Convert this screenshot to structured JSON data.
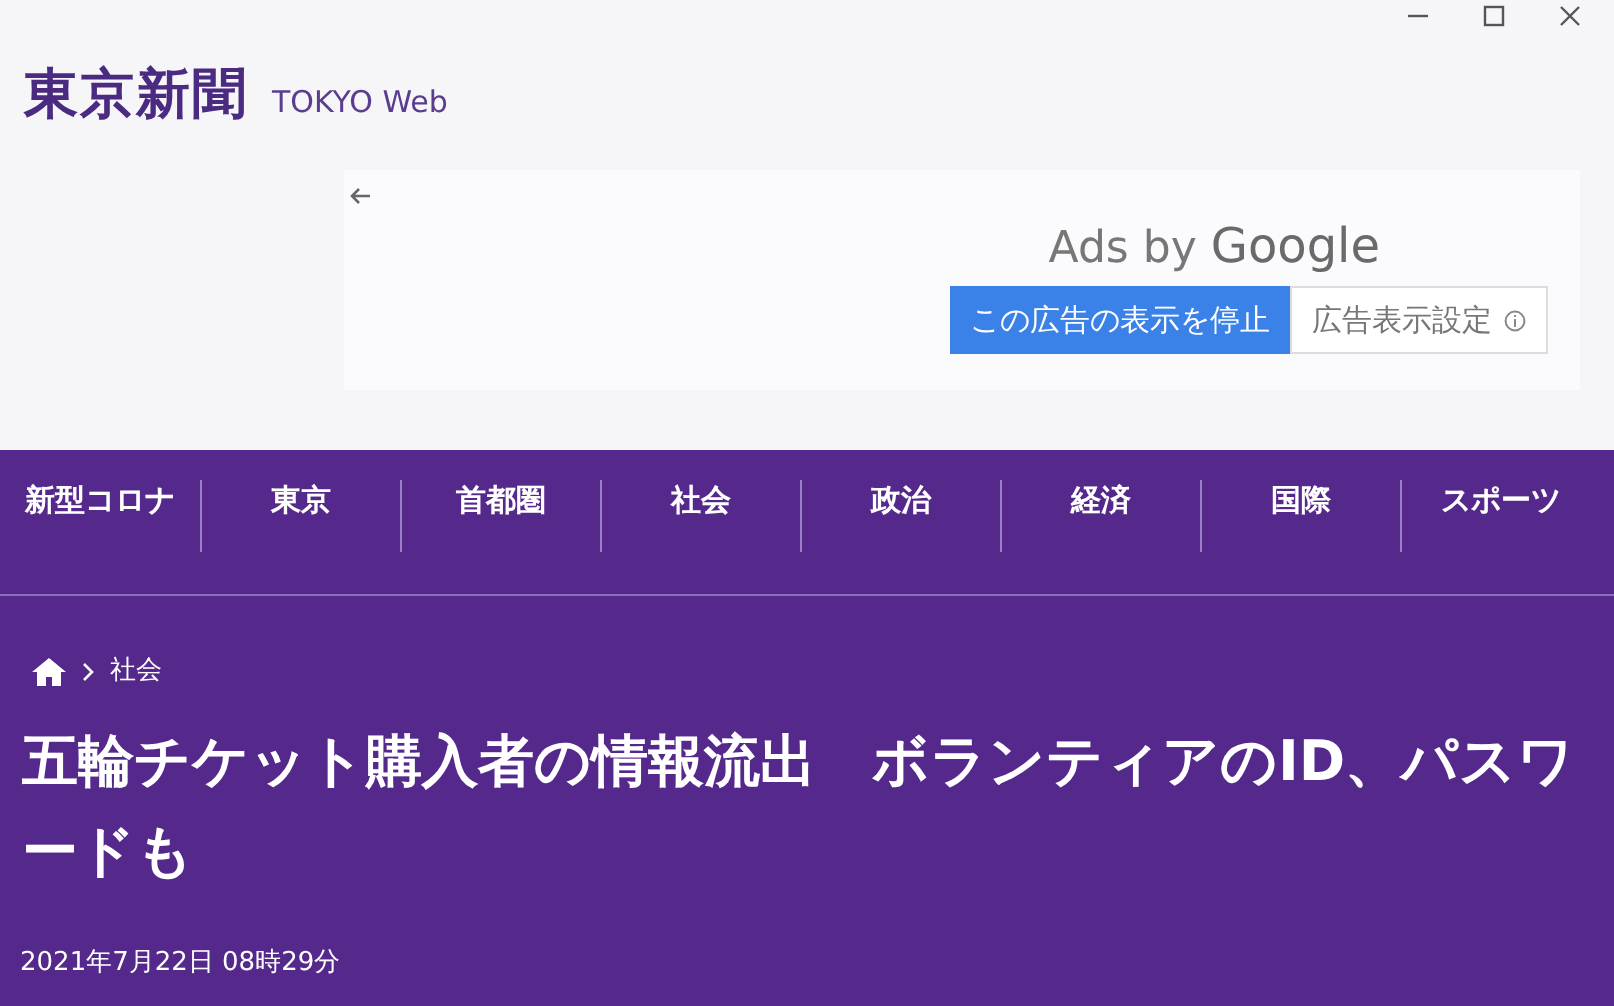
{
  "header": {
    "logo": "東京新聞",
    "logo_sub": "TOKYO Web"
  },
  "ad": {
    "label_prefix": "Ads by",
    "label_brand": "Google",
    "buttons": [
      {
        "label": "この広告の表示を停止",
        "kind": "primary"
      },
      {
        "label": "広告表示設定",
        "kind": "info"
      }
    ]
  },
  "nav": {
    "items": [
      {
        "label": "新型コロナ"
      },
      {
        "label": "東京"
      },
      {
        "label": "首都圏"
      },
      {
        "label": "社会"
      },
      {
        "label": "政治"
      },
      {
        "label": "経済"
      },
      {
        "label": "国際"
      },
      {
        "label": "スポーツ"
      }
    ]
  },
  "breadcrumb": [
    "社会"
  ],
  "article": {
    "title": "五輪チケット購入者の情報流出　ボランティアのID、パスワードも",
    "date": "2021年7月22日 08時29分"
  }
}
